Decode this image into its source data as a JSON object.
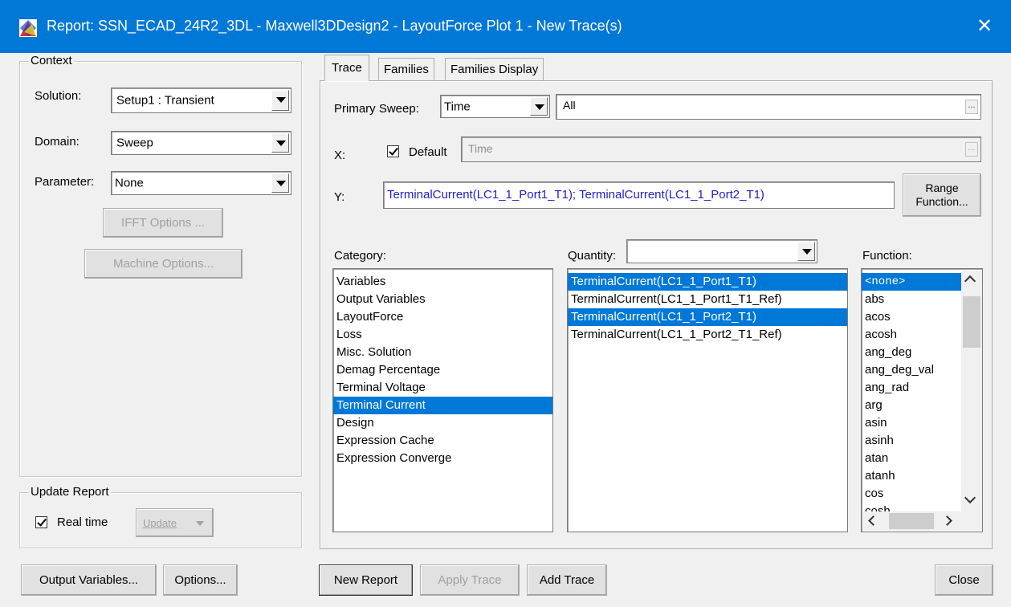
{
  "window": {
    "title": "Report: SSN_ECAD_24R2_3DL - Maxwell3DDesign2 - LayoutForce Plot 1 - New Trace(s)",
    "close_glyph": "✕"
  },
  "context": {
    "group_label": "Context",
    "solution_label": "Solution:",
    "solution_value": "Setup1 : Transient",
    "domain_label": "Domain:",
    "domain_value": "Sweep",
    "parameter_label": "Parameter:",
    "parameter_value": "None",
    "ifft_button": "IFFT Options ...",
    "machine_button": "Machine Options..."
  },
  "update_report": {
    "group_label": "Update Report",
    "realtime_label": "Real time",
    "realtime_checked": true,
    "update_button": "Update"
  },
  "tabs": [
    {
      "label": "Trace",
      "active": true
    },
    {
      "label": "Families",
      "active": false
    },
    {
      "label": "Families Display",
      "active": false
    }
  ],
  "trace": {
    "primary_sweep_label": "Primary Sweep:",
    "primary_sweep_value": "Time",
    "sweep_range_value": "All",
    "x_label": "X:",
    "default_label": "Default",
    "default_checked": true,
    "x_value": "Time",
    "y_label": "Y:",
    "y_value": "TerminalCurrent(LC1_1_Port1_T1); TerminalCurrent(LC1_1_Port2_T1)",
    "range_function_button": "Range Function...",
    "ellipsis": "..."
  },
  "category": {
    "label": "Category:",
    "items": [
      {
        "text": "Variables",
        "selected": false
      },
      {
        "text": "Output Variables",
        "selected": false
      },
      {
        "text": "LayoutForce",
        "selected": false
      },
      {
        "text": "Loss",
        "selected": false
      },
      {
        "text": "Misc. Solution",
        "selected": false
      },
      {
        "text": "Demag Percentage",
        "selected": false
      },
      {
        "text": "Terminal Voltage",
        "selected": false
      },
      {
        "text": "Terminal Current",
        "selected": true
      },
      {
        "text": "Design",
        "selected": false
      },
      {
        "text": "Expression Cache",
        "selected": false
      },
      {
        "text": "Expression Converge",
        "selected": false
      }
    ]
  },
  "quantity": {
    "label": "Quantity:",
    "filter_value": "",
    "items": [
      {
        "text": "TerminalCurrent(LC1_1_Port1_T1)",
        "selected": true
      },
      {
        "text": "TerminalCurrent(LC1_1_Port1_T1_Ref)",
        "selected": false
      },
      {
        "text": "TerminalCurrent(LC1_1_Port2_T1)",
        "selected": true
      },
      {
        "text": "TerminalCurrent(LC1_1_Port2_T1_Ref)",
        "selected": false
      }
    ]
  },
  "function": {
    "label": "Function:",
    "items": [
      {
        "text": "<none>",
        "selected": true
      },
      {
        "text": "abs",
        "selected": false
      },
      {
        "text": "acos",
        "selected": false
      },
      {
        "text": "acosh",
        "selected": false
      },
      {
        "text": "ang_deg",
        "selected": false
      },
      {
        "text": "ang_deg_val",
        "selected": false
      },
      {
        "text": "ang_rad",
        "selected": false
      },
      {
        "text": "arg",
        "selected": false
      },
      {
        "text": "asin",
        "selected": false
      },
      {
        "text": "asinh",
        "selected": false
      },
      {
        "text": "atan",
        "selected": false
      },
      {
        "text": "atanh",
        "selected": false
      },
      {
        "text": "cos",
        "selected": false
      },
      {
        "text": "cosh",
        "selected": false
      }
    ]
  },
  "buttons": {
    "output_variables": "Output Variables...",
    "options": "Options...",
    "new_report": "New Report",
    "apply_trace": "Apply Trace",
    "add_trace": "Add Trace",
    "close": "Close"
  }
}
